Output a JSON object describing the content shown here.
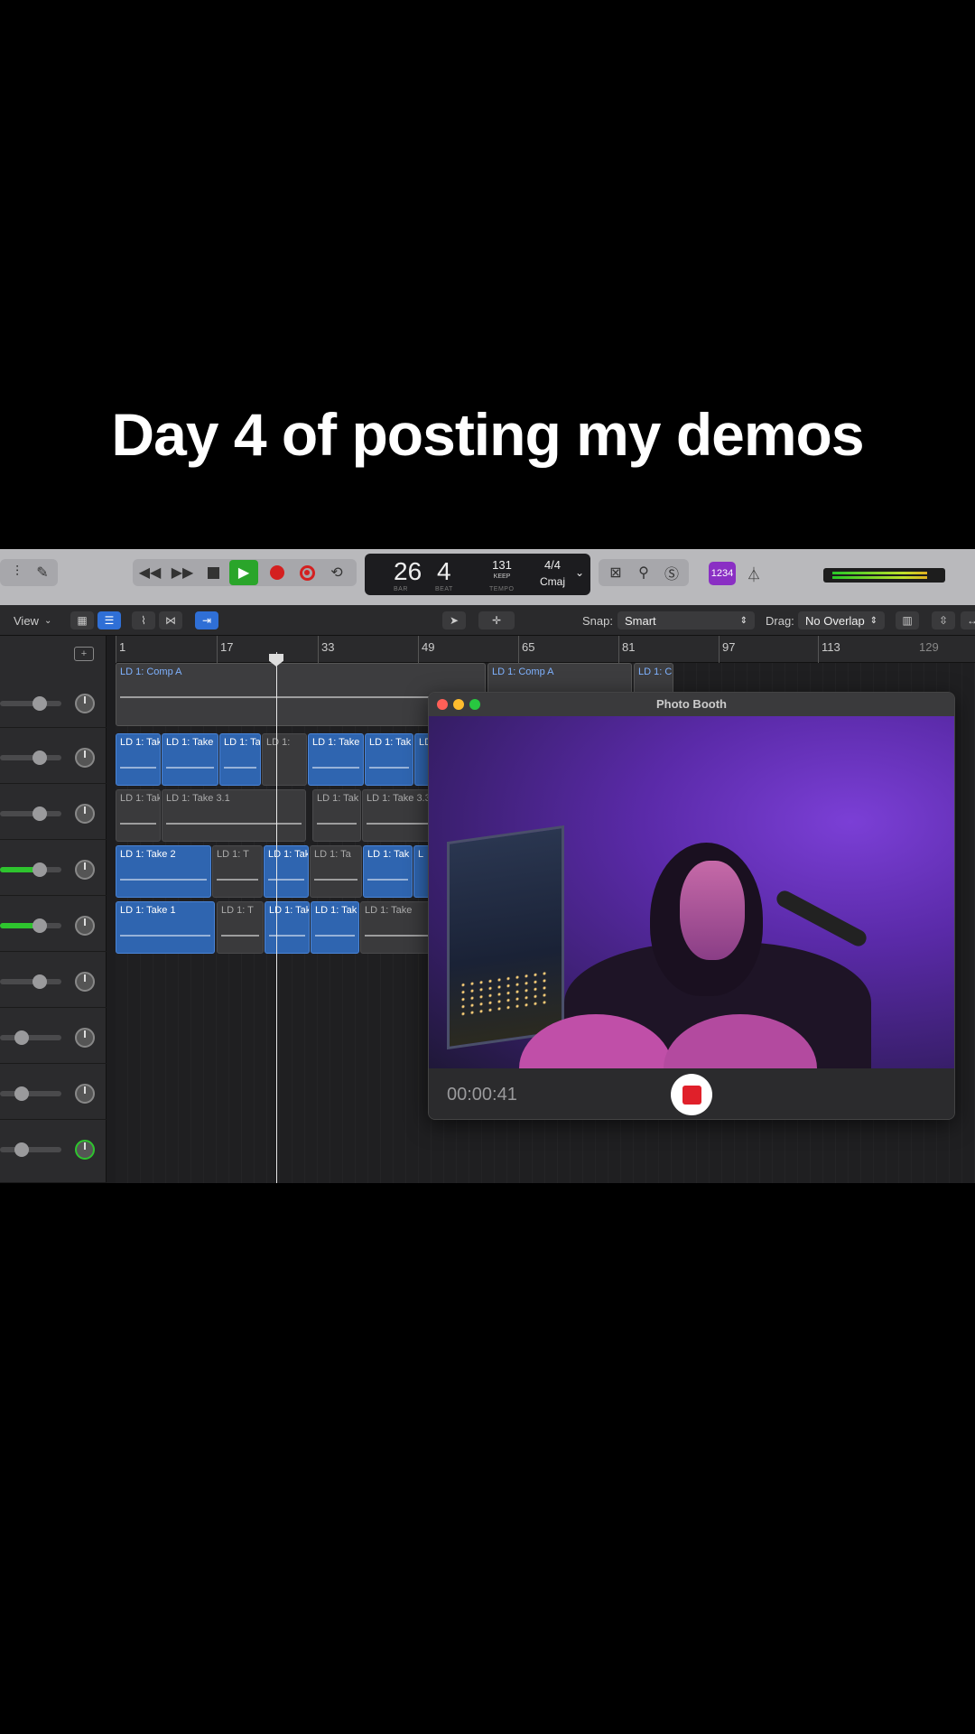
{
  "caption": "Day 4 of posting my demos",
  "transport": {
    "rewind_icon": "rewind-icon",
    "forward_icon": "fast-forward-icon",
    "bar": "26",
    "beat": "4",
    "bar_label": "BAR",
    "beat_label": "BEAT",
    "tempo": "131",
    "tempo_mode": "KEEP",
    "tempo_label": "TEMPO",
    "time_signature": "4/4",
    "key": "Cmaj",
    "count_in": "1234"
  },
  "toolbar": {
    "view_label": "View",
    "snap_label": "Snap:",
    "snap_value": "Smart",
    "drag_label": "Drag:",
    "drag_value": "No Overlap"
  },
  "ruler": [
    "1",
    "17",
    "33",
    "49",
    "65",
    "81",
    "97",
    "113",
    "129"
  ],
  "regions": {
    "comp_a_1": "LD 1: Comp A",
    "comp_a_2": "LD 1: Comp A",
    "comp_c": "LD 1: C",
    "t1": "LD 1: Tak",
    "t2": "LD 1: Take",
    "t3": "LD 1: Ta",
    "t4": "LD 1:",
    "t5": "LD 1: Take",
    "t6": "LD 1: Tak",
    "t7": "LD",
    "r3a": "LD 1: Tak",
    "r3b": "LD 1: Take 3.1",
    "r3c": "LD 1: Tak",
    "r3d": "LD 1: Take 3.3",
    "r4a": "LD 1: Take 2",
    "r4b": "LD 1: T",
    "r4c": "LD 1: Tak",
    "r4d": "LD 1: Ta",
    "r4e": "LD 1: Tak",
    "r4f": "L",
    "r5a": "LD 1: Take 1",
    "r5b": "LD 1: T",
    "r5c": "LD 1: Tak",
    "r5d": "LD 1: Tak",
    "r5e": "LD 1: Take"
  },
  "photobooth": {
    "title": "Photo Booth",
    "timer": "00:00:41"
  },
  "colors": {
    "play": "#2aa52a",
    "record": "#d42020",
    "region_blue": "#2f65b0",
    "count_in": "#8a2fc4"
  }
}
